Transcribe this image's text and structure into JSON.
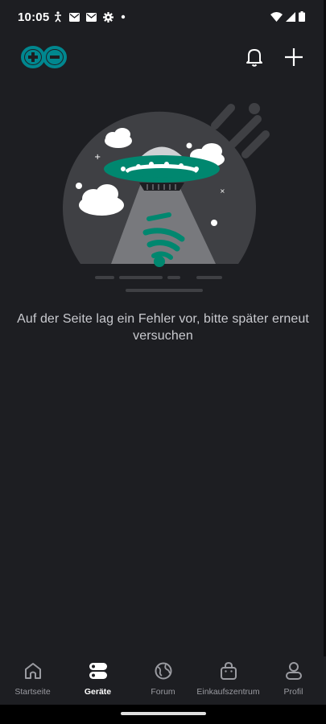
{
  "status_bar": {
    "time": "10:05",
    "left_icons": [
      "accessibility-icon",
      "mail-icon",
      "mail-icon",
      "settings-icon",
      "dot-icon"
    ],
    "right_icons": [
      "wifi-icon",
      "cell-signal-icon",
      "battery-icon"
    ]
  },
  "header": {
    "logo": "arduino-logo",
    "accent_color": "#00878f",
    "actions": [
      "bell-icon",
      "plus-icon"
    ]
  },
  "empty_state": {
    "illustration": "ufo-wifi-illustration",
    "message": "Auf der Seite lag ein Fehler vor, bitte später erneut versuchen"
  },
  "bottom_nav": {
    "items": [
      {
        "label": "Startseite",
        "icon": "home-icon",
        "active": false
      },
      {
        "label": "Geräte",
        "icon": "devices-icon",
        "active": true
      },
      {
        "label": "Forum",
        "icon": "globe-icon",
        "active": false
      },
      {
        "label": "Einkaufszentrum",
        "icon": "shopping-bag-icon",
        "active": false
      },
      {
        "label": "Profil",
        "icon": "profile-icon",
        "active": false
      }
    ]
  }
}
